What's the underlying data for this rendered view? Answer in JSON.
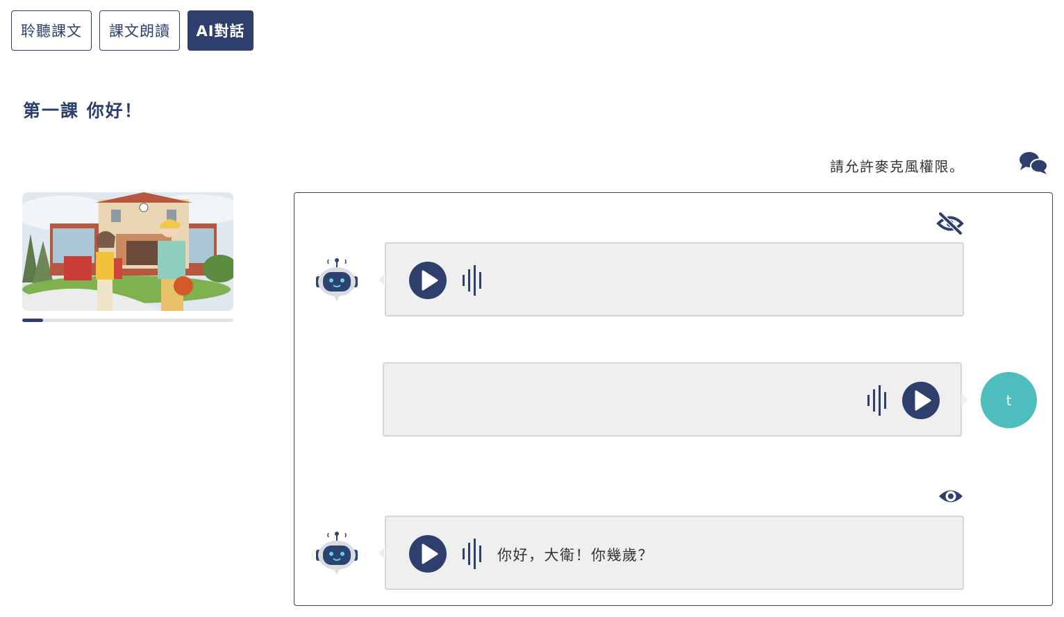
{
  "tabs": [
    {
      "label": "聆聽課文"
    },
    {
      "label": "課文朗讀"
    },
    {
      "label": "AI對話",
      "active": true
    }
  ],
  "lesson": {
    "title": "第一課 你好！"
  },
  "mic_status": "請允許麥克風權限。",
  "video": {
    "progress_percent": 10
  },
  "messages": [
    {
      "speaker": "bot",
      "text": "",
      "text_visible": false
    },
    {
      "speaker": "user",
      "text": ""
    },
    {
      "speaker": "bot",
      "text": "你好，大衛！你幾歲？",
      "text_visible": true
    }
  ],
  "user": {
    "avatar_initial": "t"
  },
  "icons": {
    "chat": "chat-bubbles-icon",
    "hide": "eye-slash-icon",
    "show": "eye-icon",
    "play": "play-icon",
    "wave": "sound-wave-icon",
    "bot": "robot-icon"
  },
  "colors": {
    "primary": "#2e3f6e",
    "avatar": "#4dbdbd",
    "bubble": "#efefef",
    "robot_face": "#2c4370"
  }
}
